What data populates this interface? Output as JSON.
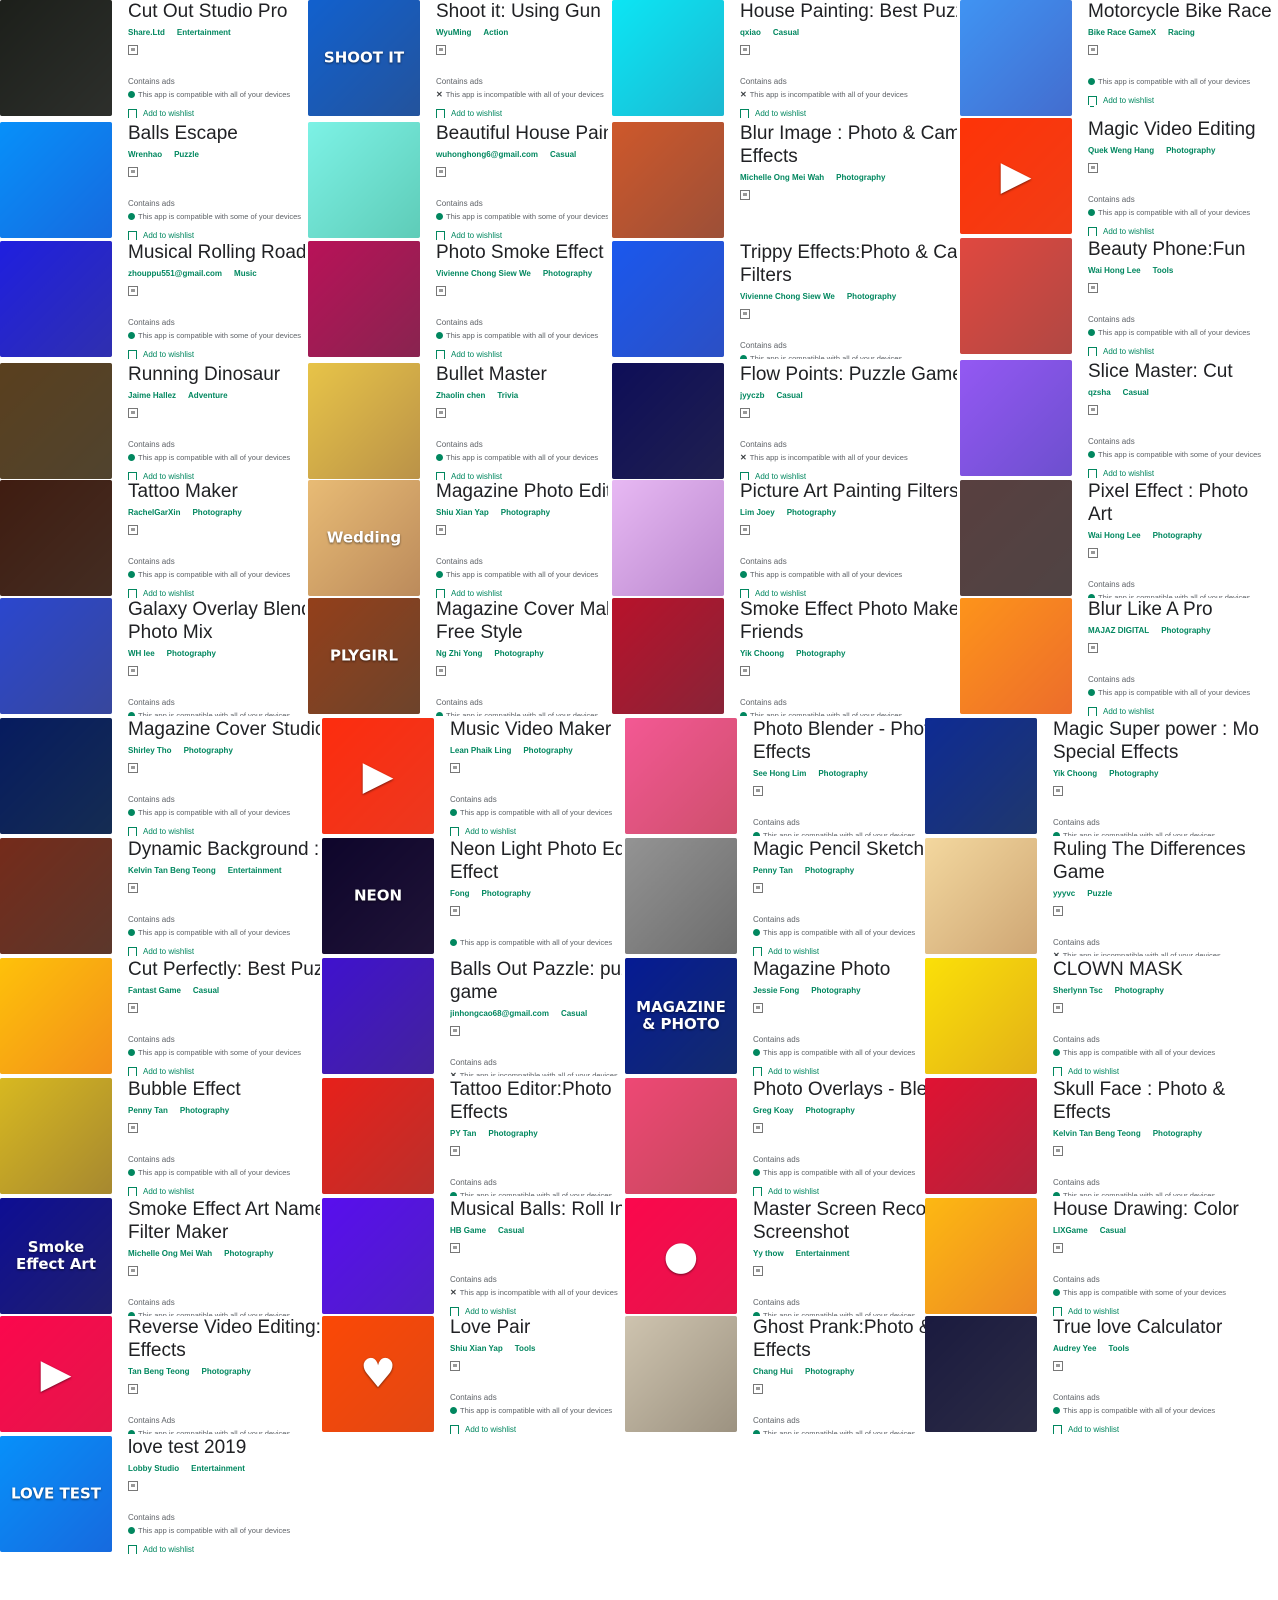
{
  "common": {
    "contains_ads": "Contains ads",
    "add_to_wishlist": "Add to wishlist"
  },
  "apps": [
    {
      "title": "Cut Out Studio Pro",
      "dev": "Share.Ltd",
      "cat": "Entertainment",
      "ads": "Contains ads",
      "compat": "This app is compatible with all of your devices",
      "compat_ok": true,
      "wish": "Add to wishlist",
      "thumb_color": "#3c3f3a",
      "thumb_text": ""
    },
    {
      "title": "Balls Escape",
      "dev": "Wrenhao",
      "cat": "Puzzle",
      "ads": "Contains ads",
      "compat": "This app is compatible with some of your devices",
      "compat_ok": true,
      "wish": "Add to wishlist",
      "thumb_color": "#1e88e5",
      "thumb_text": ""
    },
    {
      "title": "Musical Rolling Road",
      "dev": "zhouppu551@gmail.com",
      "cat": "Music",
      "ads": "Contains ads",
      "compat": "This app is compatible with some of your devices",
      "compat_ok": true,
      "wish": "Add to wishlist",
      "thumb_color": "#3f3fbf",
      "thumb_text": ""
    },
    {
      "title": "Running Dinosaur",
      "dev": "Jaime Hallez",
      "cat": "Adventure",
      "ads": "Contains ads",
      "compat": "This app is compatible with all of your devices",
      "compat_ok": true,
      "wish": "Add to wishlist",
      "thumb_color": "#6b5a3e",
      "thumb_text": ""
    },
    {
      "title": "Tattoo Maker",
      "dev": "RachelGarXin",
      "cat": "Photography",
      "ads": "Contains ads",
      "compat": "This app is compatible with all of your devices",
      "compat_ok": true,
      "wish": "Add to wishlist",
      "thumb_color": "#5a3c2e",
      "thumb_text": ""
    },
    {
      "title": "Galaxy Overlay Blender",
      "title2": "Photo Mix",
      "dev": "WH lee",
      "cat": "Photography",
      "ads": "Contains ads",
      "compat": "This app is compatible with all of your devices",
      "compat_ok": true,
      "wish": "Add to wishlist",
      "thumb_color": "#4a5fb0",
      "thumb_text": ""
    },
    {
      "title": "Magazine Cover Studio",
      "dev": "Shirley Tho",
      "cat": "Photography",
      "ads": "Contains ads",
      "compat": "This app is compatible with all of your devices",
      "compat_ok": true,
      "wish": "Add to wishlist",
      "thumb_color": "#1c3b6e",
      "thumb_text": ""
    },
    {
      "title": "Dynamic Background : Live",
      "dev": "Kelvin Tan Beng Teong",
      "cat": "Entertainment",
      "ads": "Contains ads",
      "compat": "This app is compatible with all of your devices",
      "compat_ok": true,
      "wish": "Add to wishlist",
      "thumb_color": "#7a4a3a",
      "thumb_text": ""
    },
    {
      "title": "Cut Perfectly: Best Puzzle",
      "dev": "Fantast Game",
      "cat": "Casual",
      "ads": "Contains ads",
      "compat": "This app is compatible with some of your devices",
      "compat_ok": true,
      "wish": "Add to wishlist",
      "thumb_color": "#f5a623",
      "thumb_text": ""
    },
    {
      "title": "Bubble Effect",
      "dev": "Penny Tan",
      "cat": "Photography",
      "ads": "Contains ads",
      "compat": "This app is compatible with all of your devices",
      "compat_ok": true,
      "wish": "Add to wishlist",
      "thumb_color": "#b8a040",
      "thumb_text": ""
    },
    {
      "title": "Smoke Effect Art Name",
      "title2": "Filter Maker",
      "dev": "Michelle Ong Mei Wah",
      "cat": "Photography",
      "ads": "Contains ads",
      "compat": "This app is compatible with all of your devices",
      "compat_ok": true,
      "wish": "Add to wishlist",
      "thumb_color": "#2a2a8a",
      "thumb_text": "Smoke Effect Art"
    },
    {
      "title": "Reverse Video Editing:Magic",
      "title2": "Effects",
      "dev": "Tan Beng Teong",
      "cat": "Photography",
      "ads": "Contains Ads",
      "compat": "This app is compatible with all of your devices",
      "compat_ok": true,
      "wish": "",
      "thumb_color": "#e91e63",
      "thumb_text": "▶"
    },
    {
      "title": "love test 2019",
      "dev": "Lobby Studio",
      "cat": "Entertainment",
      "ads": "Contains ads",
      "compat": "This app is compatible with all of your devices",
      "compat_ok": true,
      "wish": "Add to wishlist",
      "thumb_color": "#1e88e5",
      "thumb_text": "LOVE TEST"
    },
    {
      "title": "Shoot it: Using Gun",
      "dev": "WyuMing",
      "cat": "Action",
      "ads": "Contains ads",
      "compat": "This app is incompatible with all of your devices",
      "compat_ok": false,
      "wish": "Add to wishlist",
      "thumb_color": "#2f6fb0",
      "thumb_text": "SHOOT IT"
    },
    {
      "title": "Beautiful House Painting",
      "dev": "wuhonghong6@gmail.com",
      "cat": "Casual",
      "ads": "Contains ads",
      "compat": "This app is compatible with some of your devices",
      "compat_ok": true,
      "wish": "Add to wishlist",
      "thumb_color": "#7ed6c6",
      "thumb_text": ""
    },
    {
      "title": "Photo Smoke Effect",
      "dev": "Vivienne Chong Siew We",
      "cat": "Photography",
      "ads": "Contains ads",
      "compat": "This app is compatible with all of your devices",
      "compat_ok": true,
      "wish": "Add to wishlist",
      "thumb_color": "#a0306a",
      "thumb_text": ""
    },
    {
      "title": "Bullet Master",
      "dev": "Zhaolin chen",
      "cat": "Trivia",
      "ads": "Contains ads",
      "compat": "This app is compatible with all of your devices",
      "compat_ok": true,
      "wish": "Add to wishlist",
      "thumb_color": "#c8a860",
      "thumb_text": ""
    },
    {
      "title": "Magazine Photo Editor",
      "dev": "Shiu Xian Yap",
      "cat": "Photography",
      "ads": "Contains ads",
      "compat": "This app is compatible with all of your devices",
      "compat_ok": true,
      "wish": "Add to wishlist",
      "thumb_color": "#c9a27a",
      "thumb_text": "Wedding"
    },
    {
      "title": "Magazine Cover Maker",
      "title2": "Free Style",
      "dev": "Ng Zhi Yong",
      "cat": "Photography",
      "ads": "Contains ads",
      "compat": "This app is compatible with all of your devices",
      "compat_ok": true,
      "wish": "",
      "thumb_color": "#8a5a3a",
      "thumb_text": "PLYGIRL"
    },
    {
      "title": "Music Video Maker",
      "dev": "Lean Phaik Ling",
      "cat": "Photography",
      "ads": "Contains ads",
      "compat": "This app is compatible with all of your devices",
      "compat_ok": true,
      "wish": "Add to wishlist",
      "thumb_color": "#f04b2a",
      "thumb_text": "▶"
    },
    {
      "title": "Neon Light Photo Editor",
      "title2": "Effect",
      "dev": "Fong",
      "cat": "Photography",
      "ads": "",
      "compat": "This app is compatible with all of your devices",
      "compat_ok": true,
      "wish": "",
      "thumb_color": "#2a1a4a",
      "thumb_text": "NEON"
    },
    {
      "title": "Balls Out Pazzle: puzzle",
      "title2": "game",
      "dev": "jinhongcao68@gmail.com",
      "cat": "Casual",
      "ads": "Contains ads",
      "compat": "This app is incompatible with all of your devices",
      "compat_ok": false,
      "wish": "",
      "thumb_color": "#5a2fb0",
      "thumb_text": ""
    },
    {
      "title": "Tattoo Editor:Photo",
      "title2": "Effects",
      "dev": "PY Tan",
      "cat": "Photography",
      "ads": "Contains ads",
      "compat": "This app is compatible with all of your devices",
      "compat_ok": true,
      "wish": "",
      "thumb_color": "#c8403a",
      "thumb_text": ""
    },
    {
      "title": "Musical Balls: Roll In",
      "dev": "HB Game",
      "cat": "Casual",
      "ads": "Contains ads",
      "compat": "This app is incompatible with all of your devices",
      "compat_ok": false,
      "wish": "Add to wishlist",
      "thumb_color": "#6a2ad0",
      "thumb_text": ""
    },
    {
      "title": "Love Pair",
      "dev": "Shiu Xian Yap",
      "cat": "Tools",
      "ads": "Contains ads",
      "compat": "This app is compatible with all of your devices",
      "compat_ok": true,
      "wish": "Add to wishlist",
      "thumb_color": "#e8601a",
      "thumb_text": "♥"
    },
    {
      "title": "House Painting: Best Puzzle",
      "dev": "qxiao",
      "cat": "Casual",
      "ads": "Contains ads",
      "compat": "This app is incompatible with all of your devices",
      "compat_ok": false,
      "wish": "Add to wishlist",
      "thumb_color": "#26c6da",
      "thumb_text": ""
    },
    {
      "title": "Blur Image : Photo & Camera",
      "title2": "Effects",
      "dev": "Michelle Ong Mei Wah",
      "cat": "Photography",
      "ads": "",
      "compat": "",
      "compat_ok": true,
      "wish": "",
      "thumb_color": "#b06a4a",
      "thumb_text": ""
    },
    {
      "title": "Trippy Effects:Photo & Camera",
      "title2": "Filters",
      "dev": "Vivienne Chong Siew We",
      "cat": "Photography",
      "ads": "Contains ads",
      "compat": "This app is compatible with all of your devices",
      "compat_ok": true,
      "wish": "",
      "thumb_color": "#3a6ad0",
      "thumb_text": ""
    },
    {
      "title": "Flow Points: Puzzle Game",
      "dev": "jyyczb",
      "cat": "Casual",
      "ads": "Contains ads",
      "compat": "This app is incompatible with all of your devices",
      "compat_ok": false,
      "wish": "Add to wishlist",
      "thumb_color": "#2a2a6a",
      "thumb_text": ""
    },
    {
      "title": "Picture Art Painting Filters",
      "dev": "Lim Joey",
      "cat": "Photography",
      "ads": "Contains ads",
      "compat": "This app is compatible with all of your devices",
      "compat_ok": true,
      "wish": "Add to wishlist",
      "thumb_color": "#c8a0d8",
      "thumb_text": ""
    },
    {
      "title": "Smoke Effect Photo Maker",
      "title2": "Friends",
      "dev": "Yik Choong",
      "cat": "Photography",
      "ads": "Contains ads",
      "compat": "This app is compatible with all of your devices",
      "compat_ok": true,
      "wish": "",
      "thumb_color": "#a0304a",
      "thumb_text": ""
    },
    {
      "title": "Photo Blender - Photo",
      "title2": "Effects",
      "dev": "See Hong Lim",
      "cat": "Photography",
      "ads": "Contains ads",
      "compat": "This app is compatible with all of your devices",
      "compat_ok": true,
      "wish": "",
      "thumb_color": "#d86a8a",
      "thumb_text": ""
    },
    {
      "title": "Magic Pencil Sketch",
      "dev": "Penny Tan",
      "cat": "Photography",
      "ads": "Contains ads",
      "compat": "This app is compatible with all of your devices",
      "compat_ok": true,
      "wish": "Add to wishlist",
      "thumb_color": "#8a8a8a",
      "thumb_text": ""
    },
    {
      "title": "Magazine Photo",
      "dev": "Jessie Fong",
      "cat": "Photography",
      "ads": "Contains ads",
      "compat": "This app is compatible with all of your devices",
      "compat_ok": true,
      "wish": "Add to wishlist",
      "thumb_color": "#1a3a8a",
      "thumb_text": "MAGAZINE & PHOTO"
    },
    {
      "title": "Photo Overlays - Blender",
      "dev": "Greg Koay",
      "cat": "Photography",
      "ads": "Contains ads",
      "compat": "This app is compatible with all of your devices",
      "compat_ok": true,
      "wish": "Add to wishlist",
      "thumb_color": "#d0607a",
      "thumb_text": ""
    },
    {
      "title": "Master Screen Recorder",
      "title2": "Screenshot",
      "dev": "Yy thow",
      "cat": "Entertainment",
      "ads": "Contains ads",
      "compat": "This app is compatible with all of your devices",
      "compat_ok": true,
      "wish": "",
      "thumb_color": "#e91e63",
      "thumb_text": "●"
    },
    {
      "title": "Ghost Prank:Photo &",
      "title2": "Effects",
      "dev": "Chang Hui",
      "cat": "Photography",
      "ads": "Contains ads",
      "compat": "This app is compatible with all of your devices",
      "compat_ok": true,
      "wish": "",
      "thumb_color": "#b0a89a",
      "thumb_text": ""
    },
    {
      "title": "Motorcycle Bike Race",
      "dev": "Bike Race GameX",
      "cat": "Racing",
      "ads": "",
      "compat": "This app is compatible with all of your devices",
      "compat_ok": true,
      "wish": "Add to wishlist",
      "thumb_color": "#5a8ad8",
      "thumb_text": ""
    },
    {
      "title": "Magic Video Editing",
      "dev": "Quek Weng Hang",
      "cat": "Photography",
      "ads": "Contains ads",
      "compat": "This app is compatible with all of your devices",
      "compat_ok": true,
      "wish": "Add to wishlist",
      "thumb_color": "#f4511e",
      "thumb_text": "▶"
    },
    {
      "title": "Beauty Phone:Fun",
      "dev": "Wai Hong Lee",
      "cat": "Tools",
      "ads": "Contains ads",
      "compat": "This app is compatible with all of your devices",
      "compat_ok": true,
      "wish": "Add to wishlist",
      "thumb_color": "#c0605a",
      "thumb_text": ""
    },
    {
      "title": "Slice Master: Cut",
      "dev": "qzsha",
      "cat": "Casual",
      "ads": "Contains ads",
      "compat": "This app is compatible with some of your devices",
      "compat_ok": true,
      "wish": "Add to wishlist",
      "thumb_color": "#8a6ad8",
      "thumb_text": ""
    },
    {
      "title": "Pixel Effect : Photo",
      "title2": "Art",
      "dev": "Wai Hong Lee",
      "cat": "Photography",
      "ads": "Contains ads",
      "compat": "This app is compatible with all of your devices",
      "compat_ok": true,
      "wish": "",
      "thumb_color": "#6a5a5a",
      "thumb_text": ""
    },
    {
      "title": "Blur Like A Pro",
      "dev": "MAJAZ DIGITAL",
      "cat": "Photography",
      "ads": "Contains ads",
      "compat": "This app is compatible with all of your devices",
      "compat_ok": true,
      "wish": "Add to wishlist",
      "thumb_color": "#f08a3a",
      "thumb_text": ""
    },
    {
      "title": "Magic Super power : Mo",
      "title2": "Special Effects",
      "dev": "Yik Choong",
      "cat": "Photography",
      "ads": "Contains ads",
      "compat": "This app is compatible with all of your devices",
      "compat_ok": true,
      "wish": "",
      "thumb_color": "#2a4a8a",
      "thumb_text": ""
    },
    {
      "title": "Ruling The Differences",
      "title2": "Game",
      "dev": "yyyvc",
      "cat": "Puzzle",
      "ads": "Contains ads",
      "compat": "This app is incompatible with all of your devices",
      "compat_ok": false,
      "wish": "",
      "thumb_color": "#d8b890",
      "thumb_text": ""
    },
    {
      "title": "CLOWN MASK",
      "dev": "Sherlynn Tsc",
      "cat": "Photography",
      "ads": "Contains ads",
      "compat": "This app is compatible with all of your devices",
      "compat_ok": true,
      "wish": "Add to wishlist",
      "thumb_color": "#e8c020",
      "thumb_text": ""
    },
    {
      "title": "Skull Face : Photo &",
      "title2": "Effects",
      "dev": "Kelvin Tan Beng Teong",
      "cat": "Photography",
      "ads": "Contains ads",
      "compat": "This app is compatible with all of your devices",
      "compat_ok": true,
      "wish": "",
      "thumb_color": "#c03050",
      "thumb_text": ""
    },
    {
      "title": "House Drawing: Color",
      "dev": "LIXGame",
      "cat": "Casual",
      "ads": "Contains ads",
      "compat": "This app is compatible with some of your devices",
      "compat_ok": true,
      "wish": "Add to wishlist",
      "thumb_color": "#f0a030",
      "thumb_text": ""
    },
    {
      "title": "True love Calculator",
      "dev": "Audrey Yee",
      "cat": "Tools",
      "ads": "Contains ads",
      "compat": "This app is compatible with all of your devices",
      "compat_ok": true,
      "wish": "Add to wishlist",
      "thumb_color": "#3a3a5a",
      "thumb_text": ""
    }
  ]
}
